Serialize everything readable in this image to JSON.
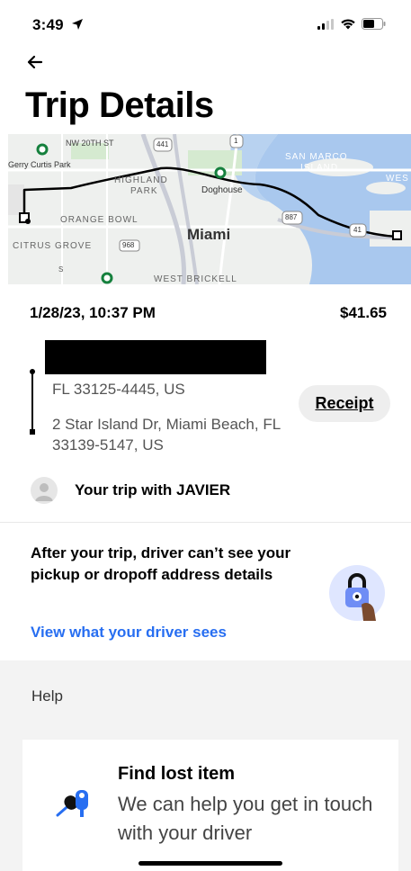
{
  "status_bar": {
    "time": "3:49"
  },
  "header": {
    "title": "Trip Details"
  },
  "map": {
    "labels": {
      "street1": "NW 20TH ST",
      "park": "Gerry Curtis Park",
      "highland_park_1": "HIGHLAND",
      "highland_park_2": "PARK",
      "doghouse": "Doghouse",
      "orange_bowl": "ORANGE BOWL",
      "citrus_grove": "CITRUS GROVE",
      "miami": "Miami",
      "san_marco_1": "SAN MARCO",
      "san_marco_2": "ISLAND",
      "wes": "WES",
      "west_brickell": "WEST BRICKELL",
      "shield_441": "441",
      "shield_1": "1",
      "shield_887": "887",
      "shield_41": "41",
      "shield_968": "968",
      "road_s": "S"
    },
    "colors": {
      "route": "#000000",
      "water": "#a9c8ee",
      "park": "#d5ead0",
      "land": "#eef0ee"
    }
  },
  "trip": {
    "date": "1/28/23, 10:37 PM",
    "price": "$41.65",
    "pickup_address": "FL 33125-4445, US",
    "dropoff_address": "2 Star Island Dr, Miami Beach, FL 33139-5147, US",
    "receipt_label": "Receipt",
    "driver_text": "Your trip with JAVIER"
  },
  "privacy": {
    "message": "After your trip, driver can’t see your pickup or dropoff address details",
    "link_label": "View what your driver sees",
    "link_color": "#276ef1"
  },
  "help": {
    "section_label": "Help",
    "card_title": "Find lost item",
    "card_description": "We can help you get in touch with your driver"
  }
}
